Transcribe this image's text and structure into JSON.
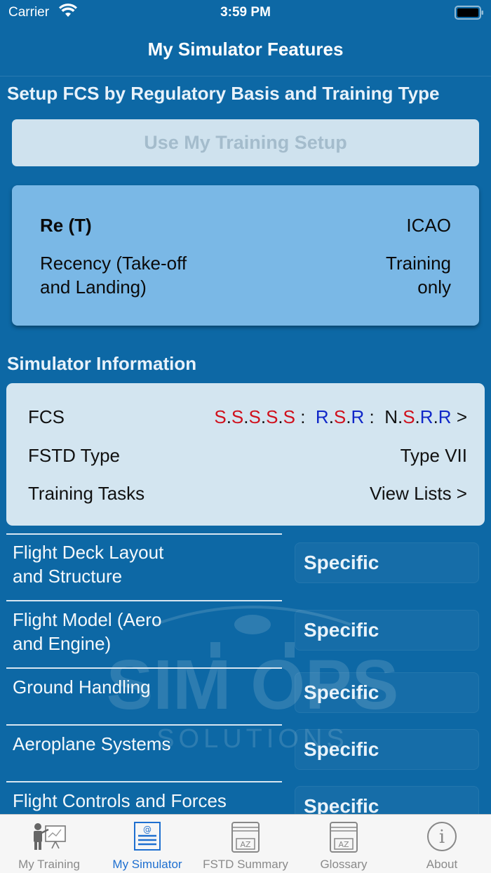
{
  "status_bar": {
    "carrier": "Carrier",
    "time": "3:59 PM"
  },
  "nav": {
    "title": "My Simulator Features"
  },
  "setup": {
    "header": "Setup FCS by Regulatory Basis and Training Type",
    "use_button": "Use My Training Setup"
  },
  "basis": {
    "code": "Re (T)",
    "regulator": "ICAO",
    "description_line1": "Recency (Take-off",
    "description_line2": "and Landing)",
    "scope_line1": "Training",
    "scope_line2": "only"
  },
  "sim_info": {
    "header": "Simulator Information",
    "fcs_label": "FCS",
    "fcs_chevron": ">",
    "fcs_code": [
      {
        "t": "S",
        "c": "red"
      },
      {
        "t": ".",
        "c": "black"
      },
      {
        "t": "S",
        "c": "red"
      },
      {
        "t": ".",
        "c": "black"
      },
      {
        "t": "S",
        "c": "red"
      },
      {
        "t": ".",
        "c": "black"
      },
      {
        "t": "S",
        "c": "red"
      },
      {
        "t": ".",
        "c": "black"
      },
      {
        "t": "S",
        "c": "red"
      },
      {
        "t": " :  ",
        "c": "black"
      },
      {
        "t": "R",
        "c": "blue"
      },
      {
        "t": ".",
        "c": "black"
      },
      {
        "t": "S",
        "c": "red"
      },
      {
        "t": ".",
        "c": "black"
      },
      {
        "t": "R",
        "c": "blue"
      },
      {
        "t": " :  ",
        "c": "black"
      },
      {
        "t": "N",
        "c": "black"
      },
      {
        "t": ".",
        "c": "black"
      },
      {
        "t": "S",
        "c": "red"
      },
      {
        "t": ".",
        "c": "black"
      },
      {
        "t": "R",
        "c": "blue"
      },
      {
        "t": ".",
        "c": "black"
      },
      {
        "t": "R",
        "c": "blue"
      }
    ],
    "fstd_type_label": "FSTD Type",
    "fstd_type_value": "Type VII",
    "tasks_label": "Training Tasks",
    "tasks_value": "View Lists >"
  },
  "features": [
    {
      "line1": "Flight Deck Layout",
      "line2": "and Structure",
      "value": "Specific"
    },
    {
      "line1": "Flight Model  (Aero",
      "line2": "and Engine)",
      "value": "Specific"
    },
    {
      "line1": "Ground Handling",
      "line2": "",
      "value": "Specific"
    },
    {
      "line1": "Aeroplane Systems",
      "line2": "",
      "value": "Specific"
    },
    {
      "line1": "Flight Controls and Forces",
      "line2": "",
      "value": "Specific"
    }
  ],
  "watermark": {
    "line1": "SIM OPS",
    "line2": "SOLUTIONS"
  },
  "tabs": [
    {
      "label": "My Training",
      "icon": "trainer-icon",
      "active": false
    },
    {
      "label": "My Simulator",
      "icon": "document-icon",
      "active": true
    },
    {
      "label": "FSTD Summary",
      "icon": "book-az-icon",
      "active": false
    },
    {
      "label": "Glossary",
      "icon": "book-az-icon",
      "active": false
    },
    {
      "label": "About",
      "icon": "info-icon",
      "active": false
    }
  ],
  "colors": {
    "background": "#0d68a5",
    "card_light": "#d3e5f0",
    "card_basis": "#7ab8e6",
    "fcs_red": "#d0101c",
    "fcs_blue": "#1027c8",
    "tab_active": "#1e6fd0"
  }
}
